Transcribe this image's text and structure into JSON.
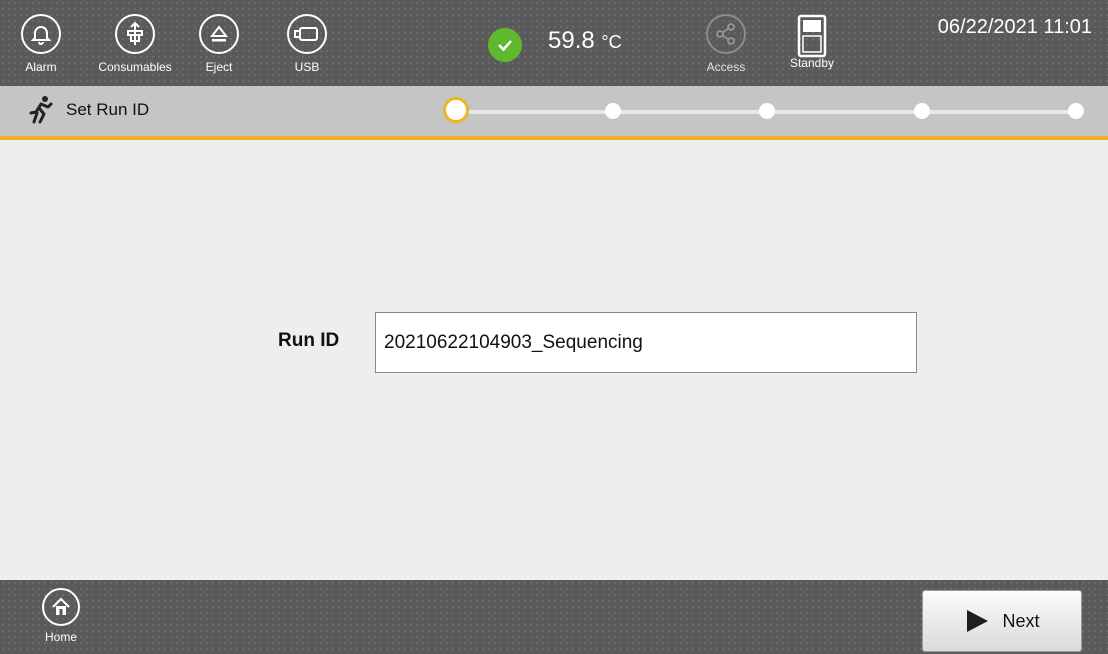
{
  "topbar": {
    "buttons": [
      {
        "label": "Alarm",
        "icon": "bell-icon"
      },
      {
        "label": "Consumables",
        "icon": "consumables-icon"
      },
      {
        "label": "Eject",
        "icon": "eject-icon"
      },
      {
        "label": "USB",
        "icon": "usb-icon"
      }
    ],
    "temperature": {
      "value": "59.8",
      "unit": "°C"
    },
    "access_label": "Access",
    "standby_label": "Standby",
    "datetime": "06/22/2021 11:01"
  },
  "step_bar": {
    "title": "Set Run ID",
    "current_step": 1,
    "total_steps": 5
  },
  "form": {
    "run_id_label": "Run ID",
    "run_id_value": "20210622104903_Sequencing"
  },
  "bottombar": {
    "home_label": "Home",
    "next_label": "Next"
  },
  "colors": {
    "accent": "#f0b323",
    "status_ok": "#5fb92f",
    "bar_dark": "#5a5a5a",
    "bar_light": "#c5c5c5",
    "page_bg": "#efeeec"
  }
}
